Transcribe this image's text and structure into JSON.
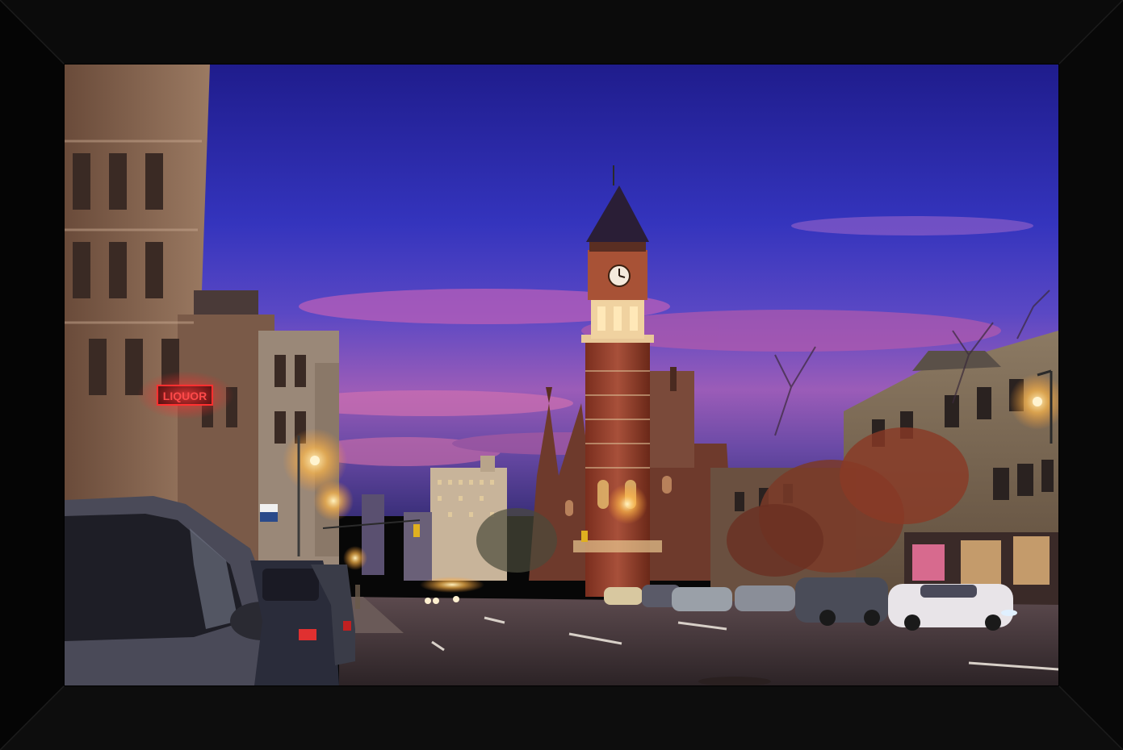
{
  "scene": {
    "liquor_sign": "LIQUOR",
    "colors": {
      "frame": "#070707",
      "sky_top": "#25208f",
      "sky_mid": "#3b3ac4",
      "sky_sunset": "#b35aa8",
      "street_light": "#ffc870",
      "sign_red": "#e02020",
      "brick": "#8a3a26"
    }
  }
}
